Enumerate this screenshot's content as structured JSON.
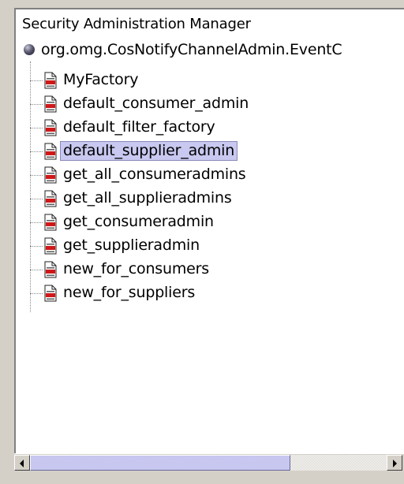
{
  "tree": {
    "title": "Security Administration Manager",
    "root": {
      "label": "org.omg.CosNotifyChannelAdmin.EventC",
      "icon": "globe-icon"
    },
    "items": [
      {
        "label": "MyFactory",
        "icon": "document-icon",
        "selected": false
      },
      {
        "label": "default_consumer_admin",
        "icon": "document-icon",
        "selected": false
      },
      {
        "label": "default_filter_factory",
        "icon": "document-icon",
        "selected": false
      },
      {
        "label": "default_supplier_admin",
        "icon": "document-icon",
        "selected": true
      },
      {
        "label": "get_all_consumeradmins",
        "icon": "document-icon",
        "selected": false
      },
      {
        "label": "get_all_supplieradmins",
        "icon": "document-icon",
        "selected": false
      },
      {
        "label": "get_consumeradmin",
        "icon": "document-icon",
        "selected": false
      },
      {
        "label": "get_supplieradmin",
        "icon": "document-icon",
        "selected": false
      },
      {
        "label": "new_for_consumers",
        "icon": "document-icon",
        "selected": false
      },
      {
        "label": "new_for_suppliers",
        "icon": "document-icon",
        "selected": false
      }
    ]
  },
  "scrollbar": {
    "orientation": "horizontal",
    "thumb_fraction": 0.73,
    "thumb_position": 0.0
  },
  "colors": {
    "selection_bg": "#c8c8f0",
    "panel_bg": "#ffffff",
    "chrome_bg": "#d4d0c8",
    "doc_icon_red": "#d01818"
  }
}
